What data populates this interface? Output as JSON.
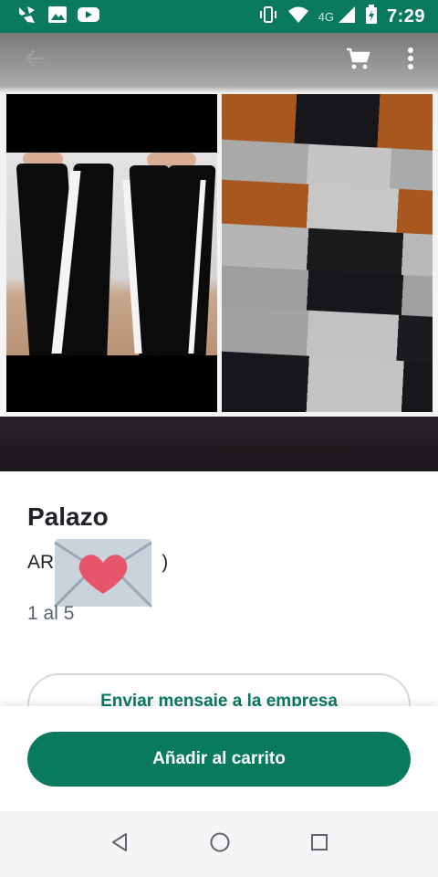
{
  "status_bar": {
    "time": "7:29",
    "network_type": "4G",
    "icons": [
      "app-notification-icon",
      "image-icon",
      "youtube-icon",
      "vibrate-icon",
      "wifi-icon",
      "signal-icon",
      "battery-icon"
    ]
  },
  "toolbar": {
    "icons": [
      "back-arrow-icon",
      "cart-icon",
      "more-vert-icon"
    ]
  },
  "product": {
    "title": "Palazo",
    "price_prefix": "AR",
    "price_suffix": ")",
    "sizes": "1 al 5"
  },
  "actions": {
    "message_label": "Enviar mensaje a la empresa",
    "add_to_cart_label": "Añadir al carrito"
  },
  "colors": {
    "brand": "#0a7a5f",
    "text": "#1f2328",
    "muted": "#5a6470"
  },
  "nav_bar": {
    "icons": [
      "back-triangle-icon",
      "home-circle-icon",
      "recents-square-icon"
    ]
  }
}
